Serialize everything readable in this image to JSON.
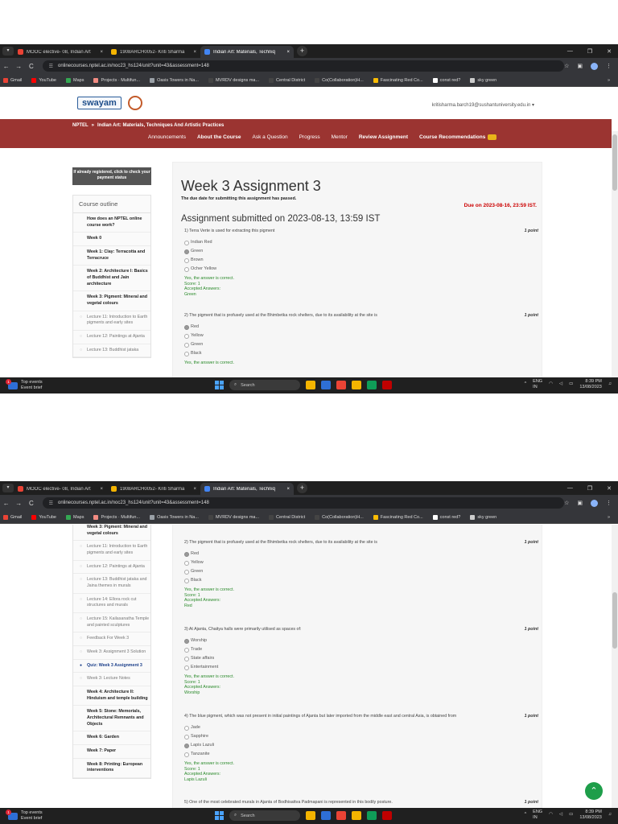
{
  "browser": {
    "tabs": [
      {
        "title": "MOOC elective- 08, Indian Art",
        "favicon_color": "#ea4335",
        "active": false
      },
      {
        "title": "1908ARCH0052- Kriti Sharma",
        "favicon_color": "#f4b400",
        "active": false
      },
      {
        "title": "Indian Art: Materials, Techniq",
        "favicon_color": "#4285f4",
        "active": true
      }
    ],
    "tab_close": "×",
    "new_tab": "+",
    "url": "onlinecourses.nptel.ac.in/noc23_hs124/unit?unit=43&assessment=148",
    "bookmarks": [
      {
        "label": "Gmail",
        "color": "#ea4335"
      },
      {
        "label": "YouTube",
        "color": "#ff0000"
      },
      {
        "label": "Maps",
        "color": "#34a853"
      },
      {
        "label": "Projects · Multifun...",
        "color": "#f28b82"
      },
      {
        "label": "Oasis Towers in Na...",
        "color": "#9aa0a6"
      },
      {
        "label": "MVRDV designs ma...",
        "color": "#444444"
      },
      {
        "label": "Central District",
        "color": "#444444"
      },
      {
        "label": "Co(Collaboration)H...",
        "color": "#444444"
      },
      {
        "label": "Fascinating Red Co...",
        "color": "#fbbc04"
      },
      {
        "label": "const red?",
        "color": "#ffffff"
      },
      {
        "label": "sky green",
        "color": "#cccccc"
      }
    ],
    "bookmarks_more": "»"
  },
  "site": {
    "logo_text": "swayam",
    "user_email": "kritisharma.barch19@sushantuniversity.edu.in",
    "user_caret": "▾",
    "breadcrumb": {
      "root": "NPTEL",
      "separator": "»",
      "course": "Indian Art: Materials, Techniques And Artistic Practices"
    },
    "nav": [
      "Announcements",
      "About the Course",
      "Ask a Question",
      "Progress",
      "Mentor",
      "Review Assignment",
      "Course Recommendations"
    ],
    "nav_new_badge": "NEW",
    "accent": "#9b3431"
  },
  "sidebar": {
    "register_button": "If already registered, click to check your payment status",
    "outline_title": "Course outline",
    "items_top": [
      {
        "label": "How does an NPTEL online course work?",
        "kind": "bold"
      },
      {
        "label": "Week 0",
        "kind": "bold"
      },
      {
        "label": "Week 1: Clay: Terracotta and Terracruce",
        "kind": "bold"
      },
      {
        "label": "Week 2: Architecture I: Basics of Buddhist and Jain architecture",
        "kind": "bold"
      },
      {
        "label": "Week 3: Pigment: Mineral and vegetal colours",
        "kind": "bold"
      },
      {
        "label": "Lecture 11: Introduction to Earth pigments and early sites",
        "kind": "sub"
      },
      {
        "label": "Lecture 12: Paintings at Ajanta",
        "kind": "sub"
      },
      {
        "label": "Lecture 13: Buddhist jataka",
        "kind": "sub"
      }
    ],
    "items_bottom": [
      {
        "label": "Week 3: Pigment: Mineral and vegetal colours",
        "kind": "bold"
      },
      {
        "label": "Lecture 11: Introduction to Earth pigments and early sites",
        "kind": "sub"
      },
      {
        "label": "Lecture 12: Paintings at Ajanta",
        "kind": "sub"
      },
      {
        "label": "Lecture 13: Buddhist jataka and Jaina themes in murals",
        "kind": "sub"
      },
      {
        "label": "Lecture 14: Ellora rock cut structures and murals",
        "kind": "sub"
      },
      {
        "label": "Lecture 15: Kailasanatha Temple and painted sculptures",
        "kind": "sub"
      },
      {
        "label": "Feedback For Week 3",
        "kind": "sub"
      },
      {
        "label": "Week 3: Assignment 3 Solution",
        "kind": "sub"
      },
      {
        "label": "Quiz: Week 3 Assignment 3",
        "kind": "active"
      },
      {
        "label": "Week 3: Lecture Notes",
        "kind": "sub"
      },
      {
        "label": "Week 4: Architecture II: Hinduism and temple building",
        "kind": "bold"
      },
      {
        "label": "Week 5: Stone: Memorials, Architectural Remnants and Objects",
        "kind": "bold"
      },
      {
        "label": "Week 6: Garden",
        "kind": "bold"
      },
      {
        "label": "Week 7: Paper",
        "kind": "bold"
      },
      {
        "label": "Week 8: Printing: European interventions",
        "kind": "bold"
      }
    ]
  },
  "assignment": {
    "title": "Week 3 Assignment 3",
    "due_note": "The due date for submitting this assignment has passed.",
    "due": "Due on 2023-08-16, 23:59 IST.",
    "submitted": "Assignment submitted on 2023-08-13, 13:59 IST",
    "q1": {
      "text": "1)   Terra Verte is used for extracting this pigment",
      "points": "1 point",
      "options": [
        "Indian Red",
        "Green",
        "Brown",
        "Ocher Yellow"
      ],
      "selected": 1,
      "feedback": [
        "Yes, the answer is correct.",
        "Score: 1",
        "Accepted Answers:",
        "Green"
      ]
    },
    "q2": {
      "text": "2)   The pigment that is profusely used at the Bhimbetka rock shelters, due to its availability at the site is",
      "points": "1 point",
      "options": [
        "Red",
        "Yellow",
        "Green",
        "Black"
      ],
      "selected": 0,
      "feedback": [
        "Yes, the answer is correct.",
        "Score: 1",
        "Accepted Answers:",
        "Red"
      ]
    },
    "q3": {
      "text": "3)   At Ajanta, Chaitya halls were primarily utilised as spaces of:",
      "points": "1 point",
      "options": [
        "Worship",
        "Trade",
        "State affairs",
        "Entertainment"
      ],
      "selected": 0,
      "feedback": [
        "Yes, the answer is correct.",
        "Score: 1",
        "Accepted Answers:",
        "Worship"
      ]
    },
    "q4": {
      "text": "4)   The blue pigment, which was not present in initial paintings of Ajanta but later imported from the middle east and central Asia, is obtained from",
      "points": "1 point",
      "options": [
        "Jade",
        "Sapphire",
        "Lapis Lazuli",
        "Tanzanite"
      ],
      "selected": 2,
      "feedback": [
        "Yes, the answer is correct.",
        "Score: 1",
        "Accepted Answers:",
        "Lapis Lazuli"
      ]
    },
    "q5": {
      "text": "5)   One of the most celebrated murals in Ajanta of Bodhisattva Padmapani is represented in this bodily posture.",
      "points": "1 point"
    },
    "q2_cut_feedback": "Yes, the answer is correct."
  },
  "taskbar": {
    "weather_title": "Top events",
    "weather_sub": "Event brief",
    "badge": "1",
    "search": "Search",
    "lang": "ENG",
    "region": "IN",
    "time": "8:39 PM",
    "date": "13/08/2023",
    "app_colors": [
      "#f4b400",
      "#2e6fd6",
      "#ea4335",
      "#f4b400",
      "#0f9d58",
      "#c00000"
    ]
  },
  "fab_icon": "chevron-up-icon"
}
